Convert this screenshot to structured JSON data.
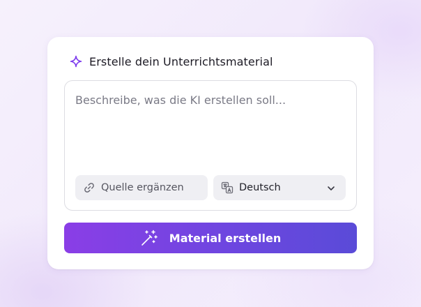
{
  "colors": {
    "accent": "#7c3aed",
    "button_start": "#8a3ee6",
    "button_end": "#5a4bd8",
    "pill_bg": "#efeff3"
  },
  "header": {
    "icon": "sparkle-icon",
    "title": "Erstelle dein Unterrichtsmaterial"
  },
  "prompt": {
    "placeholder": "Beschreibe, was die KI erstellen soll...",
    "value": ""
  },
  "source_button": {
    "icon": "link-icon",
    "label": "Quelle ergänzen"
  },
  "language_select": {
    "icon": "translate-icon",
    "selected": "Deutsch",
    "chevron": "chevron-down-icon"
  },
  "submit_button": {
    "icon": "magic-wand-icon",
    "label": "Material erstellen"
  }
}
